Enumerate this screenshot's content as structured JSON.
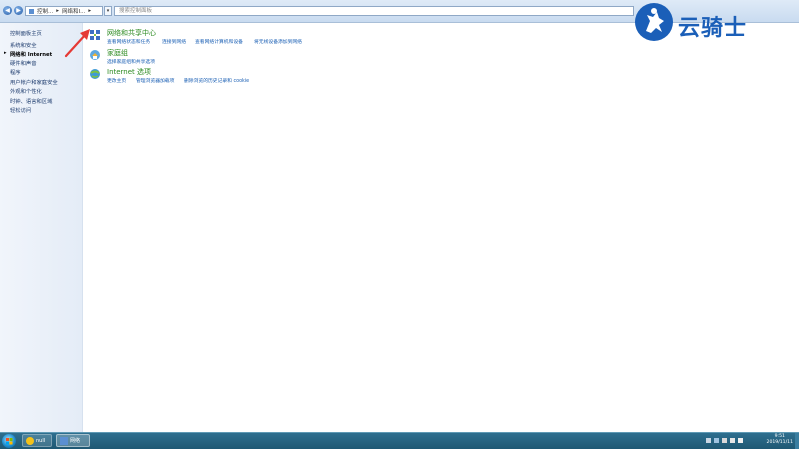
{
  "window": {
    "breadcrumb": [
      "控制...",
      "网络和I..."
    ],
    "search_placeholder": "搜索控制面板",
    "nav_back": "◀",
    "nav_forward": "▶",
    "dropdown": "▾"
  },
  "sidebar": {
    "items": [
      {
        "label": "控制面板主页"
      },
      {
        "label": "系统和安全"
      },
      {
        "label": "网络和 Internet",
        "active": true
      },
      {
        "label": "硬件和声音"
      },
      {
        "label": "程序"
      },
      {
        "label": "用户帐户和家庭安全"
      },
      {
        "label": "外观和个性化"
      },
      {
        "label": "时钟、语言和区域"
      },
      {
        "label": "轻松访问"
      }
    ]
  },
  "categories": [
    {
      "title": "网络和共享中心",
      "links": [
        "查看网络状态和任务",
        "连接到网络",
        "查看网络计算机和设备",
        "将无线设备添加到网络"
      ]
    },
    {
      "title": "家庭组",
      "links": [
        "选择家庭组和共享选项"
      ]
    },
    {
      "title": "Internet 选项",
      "links": [
        "更改主页",
        "管理浏览器加载项",
        "删除浏览的历史记录和 cookie"
      ]
    }
  ],
  "watermark": {
    "text": "云骑士"
  },
  "taskbar": {
    "tasks": [
      {
        "label": "null"
      },
      {
        "label": "网络"
      }
    ],
    "time": "9:51",
    "date": "2019/11/11"
  },
  "colors": {
    "accent": "#1b5fb8",
    "category_title": "#2b8a1f",
    "link": "#1a5fb4",
    "annotation_arrow": "#e53935"
  }
}
